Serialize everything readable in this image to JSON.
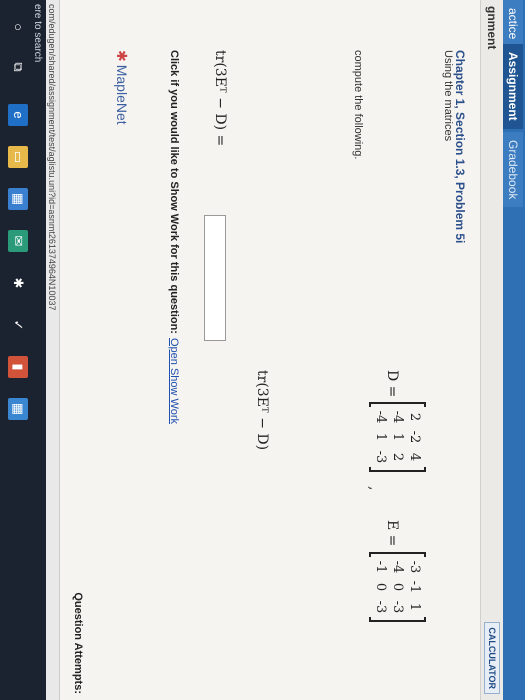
{
  "tabs": [
    "actice",
    "Assignment",
    "Gradebook"
  ],
  "page_title": "gnment",
  "calculator_label": "CALCULATOR",
  "problem": {
    "title": "Chapter 1, Section 1.3, Problem 5i",
    "intro": "Using the matrices",
    "compute_text": "compute the following.",
    "D_label": "D =",
    "D": [
      [
        "2",
        "-2",
        "4"
      ],
      [
        "-4",
        "1",
        "2"
      ],
      [
        "-4",
        "1",
        "-3"
      ]
    ],
    "E_label": "E =",
    "E": [
      [
        "-3",
        "-1",
        "1"
      ],
      [
        "-4",
        "0",
        "-3"
      ],
      [
        "-1",
        "0",
        "-3"
      ]
    ],
    "comma": ",",
    "expression_center": "tr(3Eᵀ − D)",
    "expression_question": "tr(3Eᵀ − D) ="
  },
  "answer": {
    "value": ""
  },
  "showwork": {
    "text": "Click if you would like to Show Work for this question:",
    "link": "Open Show Work"
  },
  "attempts_label": "Question Attempts:",
  "maplenet_label": "MapleNet",
  "status_url": "com/edugen/shared/assignment/test/aglistu.uni?id=asnmt261374964N10037",
  "search_text": "ere to search",
  "taskbar_icons": [
    "cortana-icon",
    "task-view-icon",
    "edge-icon",
    "file-explorer-icon",
    "store-icon",
    "mail-icon",
    "photos-icon",
    "app-icon",
    "app-icon-2",
    "app-icon-3"
  ]
}
